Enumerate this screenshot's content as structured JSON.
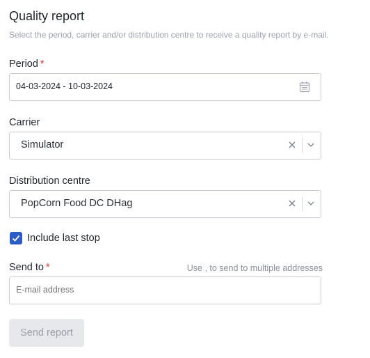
{
  "header": {
    "title": "Quality report",
    "subtitle": "Select the period, carrier and/or distribution centre to receive a quality report by e-mail."
  },
  "period": {
    "label": "Period",
    "required_mark": "*",
    "value": "04-03-2024 - 10-03-2024",
    "icon": "calendar-icon"
  },
  "carrier": {
    "label": "Carrier",
    "value": "Simulator"
  },
  "distribution_centre": {
    "label": "Distribution centre",
    "value": "PopCorn Food DC DHag"
  },
  "include_last_stop": {
    "label": "Include last stop",
    "checked": true
  },
  "send_to": {
    "label": "Send to",
    "required_mark": "*",
    "hint": "Use , to send to multiple addresses",
    "placeholder": "E-mail address",
    "value": ""
  },
  "actions": {
    "send_label": "Send report"
  },
  "colors": {
    "accent": "#2e5cc7",
    "required": "#d93838",
    "disabled_button_bg": "#e6e8ec"
  }
}
